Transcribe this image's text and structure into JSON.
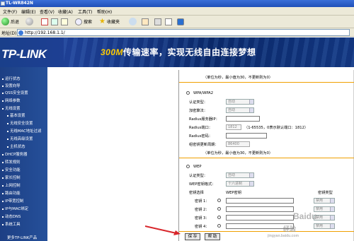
{
  "window": {
    "title": "TL-WR842N"
  },
  "menu": [
    "文件(F)",
    "编辑(E)",
    "查看(V)",
    "收藏(A)",
    "工具(T)",
    "帮助(H)"
  ],
  "toolbar": {
    "back": "后退",
    "search": "搜索",
    "favorites": "收藏夹"
  },
  "address": {
    "label": "地址(D)",
    "url": "http://192.168.1.1/"
  },
  "banner": {
    "brand": "TP-LINK",
    "slogan_prefix": "300M",
    "slogan": "传输速率，实现无线自由连接梦想"
  },
  "sidebar": {
    "items": [
      "运行状态",
      "设置向导",
      "QSS安全设置",
      "网络参数",
      "无线设置"
    ],
    "sub_items": [
      "基本设置",
      "无线安全设置",
      "无线MAC地址过滤",
      "无线高级设置",
      "主机状态"
    ],
    "items_after": [
      "DHCP服务器",
      "转发规则",
      "安全功能",
      "家长控制",
      "上网控制",
      "路由功能",
      "IP带宽控制",
      "IP与MAC绑定",
      "动态DNS",
      "系统工具"
    ],
    "footer": "更多TP-LINK产品"
  },
  "form": {
    "top_hint": "（单位为秒，最小值为30，不更新则为0）",
    "wpa": {
      "label": "WPA/WPA2",
      "auth_label": "认证类型：",
      "auth_value": "自动",
      "enc_label": "加密算法：",
      "enc_value": "自动",
      "radius_ip_label": "Radius服务器IP：",
      "radius_port_label": "Radius端口：",
      "radius_port_value": "1812",
      "radius_port_hint": "（1-65535，0表示默认端口：1812）",
      "radius_pwd_label": "Radius密码：",
      "group_key_label": "组密钥更新周期：",
      "group_key_value": "86400",
      "group_key_hint": "（单位为秒，最小值为30，不更新则为0）"
    },
    "wep": {
      "label": "WEP",
      "auth_label": "认证类型：",
      "auth_value": "自动",
      "key_format_label": "WEP密钥格式：",
      "key_format_value": "十六进制",
      "col_select": "密钥选择",
      "col_key": "WEP密钥",
      "col_type": "密钥类型",
      "keys": [
        "密钥 1：",
        "密钥 2：",
        "密钥 3：",
        "密钥 4："
      ],
      "key_type_value": "禁用"
    },
    "save_label": "保 存",
    "help_label": "帮 助"
  },
  "watermark": {
    "brand": "Baidu",
    "sub": "经验",
    "url": "jingyan.baidu.com"
  }
}
